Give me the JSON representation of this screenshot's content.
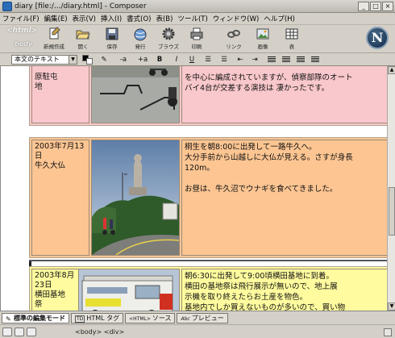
{
  "window": {
    "title": "diary [file:/.../diary.html] - Composer",
    "min": "_",
    "max": "□",
    "close": "×"
  },
  "menu": [
    "ファイル(F)",
    "編集(E)",
    "表示(V)",
    "挿入(I)",
    "書式(O)",
    "表(B)",
    "ツール(T)",
    "ウィンドウ(W)",
    "ヘルプ(H)"
  ],
  "badge": {
    "html": "<html>",
    "body": "body"
  },
  "toolbar": {
    "new": "新規作成",
    "open": "開く",
    "save": "保存",
    "publish": "発行",
    "browse": "ブラウズ",
    "print": "印刷",
    "link": "リンク",
    "image": "画像",
    "table": "表"
  },
  "throbber": "N",
  "format": {
    "paragraph": "本文のテキスト",
    "smaller": "-a",
    "larger": "+a",
    "bold": "B",
    "italic": "I",
    "underline": "U"
  },
  "entries": [
    {
      "date_lines": [
        "原駐屯",
        "地"
      ],
      "text_lines": [
        "を中心に編成されていますが、偵察部隊のオート",
        "バイ4台が交差する演技は 凄かったです。"
      ]
    },
    {
      "date_lines": [
        "2003年7月13",
        "日",
        "牛久大仏"
      ],
      "text_lines": [
        "桐生を朝8:00に出発して一路牛久へ。",
        "大分手前から山越しに大仏が見える。さすが身長",
        "120m。",
        "",
        "お昼は、牛久沼でウナギを食べてきました。"
      ]
    },
    {
      "date_lines": [
        "2003年8月",
        "23日",
        "横田基地",
        "祭"
      ],
      "text_lines": [
        "朝6:30に出発して9:00頃横田基地に到着。",
        "横田の基地祭は飛行展示が無いので、地上展",
        "示機を取り終えたらお土産を物色。",
        "基地内でしか買えないものが多いので、買い物"
      ]
    }
  ],
  "modes": [
    "標準の編集モード",
    "HTML タグ",
    "ソース",
    "プレビュー"
  ],
  "mode_icons": {
    "html_tag": "TD",
    "source": "<HTML>",
    "preview": "Abc"
  },
  "status": {
    "path": "<body> <div>"
  }
}
